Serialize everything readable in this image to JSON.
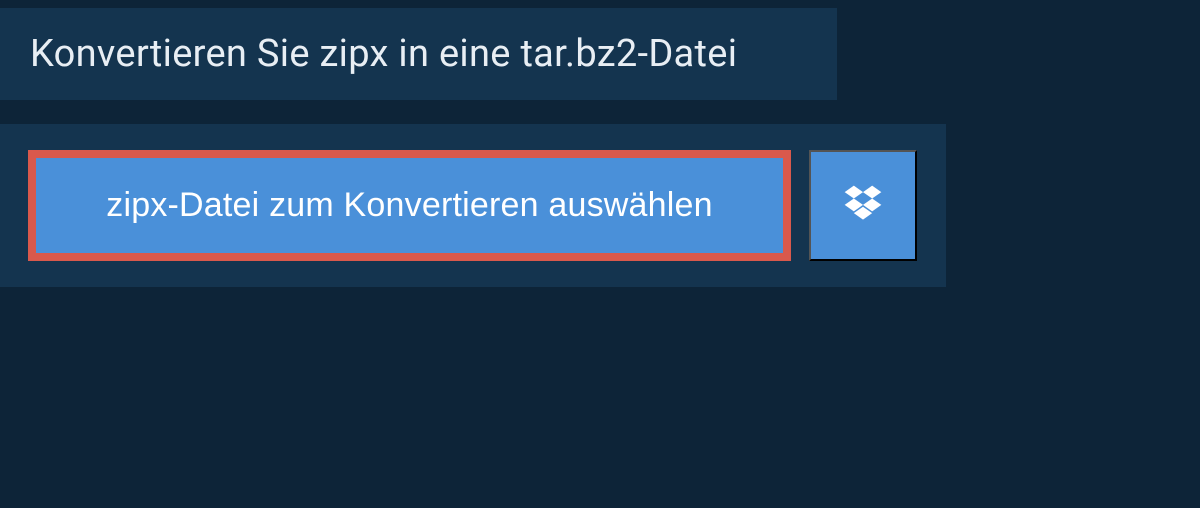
{
  "header": {
    "title": "Konvertieren Sie zipx in eine tar.bz2-Datei"
  },
  "actions": {
    "select_file_label": "zipx-Datei zum Konvertieren auswählen"
  }
}
